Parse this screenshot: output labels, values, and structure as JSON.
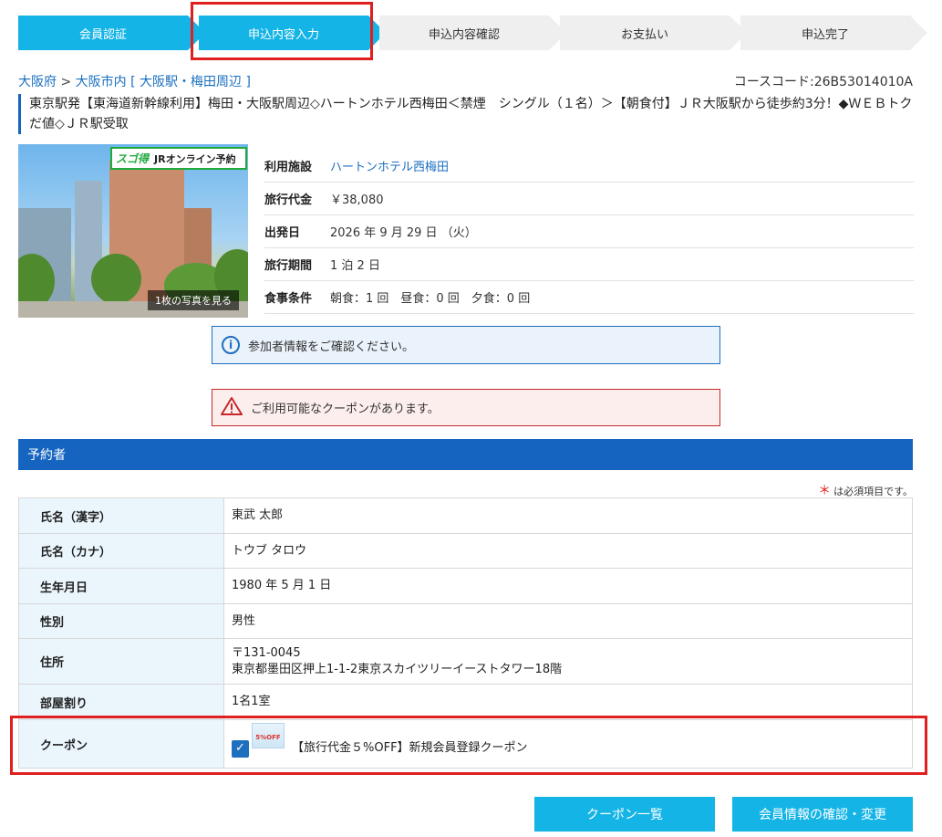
{
  "steps": [
    {
      "label": "会員認証",
      "state": "done"
    },
    {
      "label": "申込内容入力",
      "state": "active"
    },
    {
      "label": "申込内容確認",
      "state": "todo"
    },
    {
      "label": "お支払い",
      "state": "todo"
    },
    {
      "label": "申込完了",
      "state": "todo"
    }
  ],
  "breadcrumb": {
    "pref": "大阪府",
    "sep1": ">",
    "city": "大阪市内",
    "area_open": "[",
    "area": "大阪駅・梅田周辺",
    "area_close": "]"
  },
  "course_code": "コースコード:26B53014010A",
  "plan_title": "東京駅発【東海道新幹線利用】梅田・大阪駅周辺◇ハートンホテル西梅田＜禁煙　シングル（１名）＞【朝食付】ＪＲ大阪駅から徒歩約3分！◆ＷＥＢトクだ値◇ＪＲ駅受取",
  "photo": {
    "badge_left": "スゴ得",
    "badge_right": "JRオンライン予約",
    "caption": "1枚の写真を見る"
  },
  "info": [
    {
      "label": "利用施設",
      "value": "ハートンホテル西梅田",
      "link": true
    },
    {
      "label": "旅行代金",
      "value": "￥38,080",
      "link": false
    },
    {
      "label": "出発日",
      "value": "2026 年 9 月 29 日 （火）",
      "link": false
    },
    {
      "label": "旅行期間",
      "value": "1 泊 2 日",
      "link": false
    },
    {
      "label": "食事条件",
      "value": "朝食：1 回　昼食：0 回　夕食：0 回",
      "link": false
    }
  ],
  "alerts": {
    "info_icon": "info-icon",
    "info": "参加者情報をご確認ください。",
    "warn_icon": "warning-icon",
    "warn": "ご利用可能なクーポンがあります。"
  },
  "section": {
    "title": "予約者",
    "required_star": "＊",
    "required_note": "は必須項目です。"
  },
  "form": {
    "name_kanji": {
      "label": "氏名（漢字）",
      "value": "東武 太郎"
    },
    "name_kana": {
      "label": "氏名（カナ）",
      "value": "トウブ タロウ"
    },
    "birthday": {
      "label": "生年月日",
      "value": "1980 年 5 月 1 日"
    },
    "gender": {
      "label": "性別",
      "value": "男性"
    },
    "address": {
      "label": "住所",
      "zip": "〒131-0045",
      "line": "東京都墨田区押上1-1-2東京スカイツリーイーストタワー18階"
    },
    "rooms": {
      "label": "部屋割り",
      "value": "1名1室"
    },
    "coupon": {
      "label": "クーポン",
      "image_text": "5%OFF",
      "value": "【旅行代金５%OFF】新規会員登録クーポン",
      "checked": true
    }
  },
  "buttons": {
    "coupons": "クーポン一覧",
    "member": "会員情報の確認・変更"
  },
  "colors": {
    "accent": "#14b4e6",
    "header_blue": "#1565c0",
    "highlight_red": "#e01f1f"
  }
}
